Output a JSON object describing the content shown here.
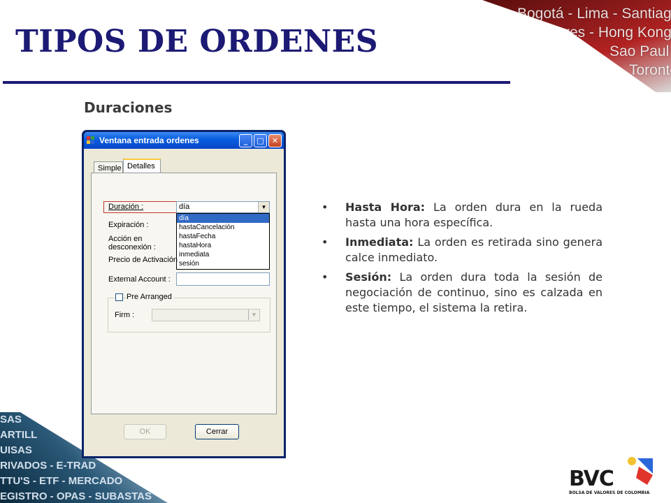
{
  "slide": {
    "title": "TIPOS DE ORDENES",
    "subtitle": "Duraciones"
  },
  "banner": {
    "cities": [
      "Bogotá - Lima - Santiag",
      "res - Hong Kong",
      "Sao Paul",
      "Toronto"
    ]
  },
  "ticker": {
    "lines": [
      "SAS",
      "ARTILL",
      "UISAS",
      "RIVADOS - E-TRAD",
      "TTU'S - ETF - MERCADO",
      "EGISTRO - OPAS - SUBASTAS"
    ]
  },
  "dialog": {
    "title": "Ventana entrada ordenes",
    "window_buttons": {
      "minimize": "_",
      "maximize": "□",
      "close": "✕"
    },
    "tabs": [
      {
        "label": "Simple",
        "active": false
      },
      {
        "label": "Detalles",
        "active": true
      }
    ],
    "fields": {
      "duracion_label": "Duración :",
      "duracion_value": "día",
      "expiracion_label": "Expiración :",
      "accion_label_1": "Acción en",
      "accion_label_2": "desconexión :",
      "precio_label": "Precio de Activación",
      "external_label": "External Account :",
      "pre_arranged_label": "Pre Arranged",
      "firm_label": "Firm :"
    },
    "duracion_options": [
      {
        "label": "día",
        "selected": true
      },
      {
        "label": "hastaCancelación",
        "selected": false
      },
      {
        "label": "hastaFecha",
        "selected": false
      },
      {
        "label": "hastaHora",
        "selected": false
      },
      {
        "label": "inmediata",
        "selected": false
      },
      {
        "label": "sesión",
        "selected": false
      }
    ],
    "buttons": {
      "ok": "OK",
      "cerrar": "Cerrar"
    }
  },
  "bullets": [
    {
      "term": "Hasta Hora:",
      "text": " La orden dura en la rueda hasta una hora específica."
    },
    {
      "term": "Inmediata:",
      "text": " La orden es retirada sino genera calce inmediato."
    },
    {
      "term": "Sesión:",
      "text": " La orden dura toda la sesión de negociación de continuo, sino es calzada en este tiempo, el sistema la retira."
    }
  ],
  "logo": {
    "name": "BVC",
    "tagline": "BOLSA DE VALORES DE COLOMBIA"
  },
  "colors": {
    "title": "#1c1a74",
    "xp_titlebar": "#0a5fe0",
    "selection": "#316ac5",
    "highlight_border": "#c0392b"
  }
}
